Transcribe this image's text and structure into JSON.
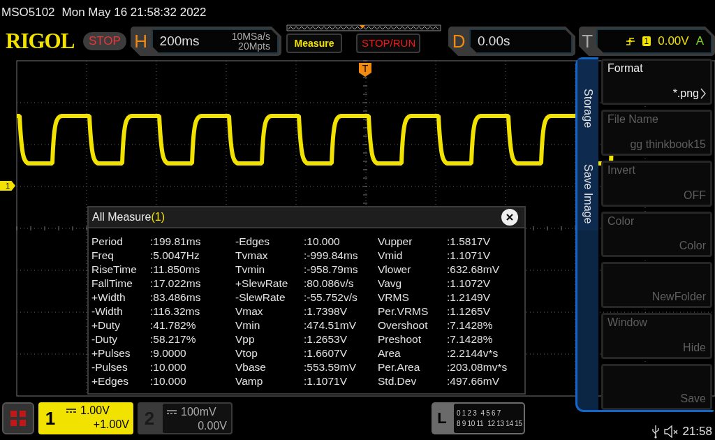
{
  "header": {
    "model": "MSO5102",
    "datetime": "Mon May 16 21:58:32 2022"
  },
  "toolbar": {
    "logo": "RIGOL",
    "run_state": "STOP",
    "horizontal": {
      "key": "H",
      "timebase": "200ms",
      "sample_rate": "10MSa/s",
      "memory_depth": "20Mpts"
    },
    "buttons": [
      {
        "label": "Measure",
        "kind": "measure"
      },
      {
        "label": "STOP/RUN",
        "kind": "stoprun"
      }
    ],
    "delay": {
      "key": "D",
      "value": "0.00s"
    },
    "trigger": {
      "key": "T",
      "source": "1",
      "level": "0.00V",
      "mode": "A"
    }
  },
  "display": {
    "channel_marker": "1",
    "trigger_marker": "T"
  },
  "measure_panel": {
    "title": "All Measure",
    "count": "(1)",
    "columns": [
      [
        {
          "name": "Period",
          "value": ":199.81ms"
        },
        {
          "name": "Freq",
          "value": ":5.0047Hz"
        },
        {
          "name": "RiseTime",
          "value": ":11.850ms"
        },
        {
          "name": "FallTime",
          "value": ":17.022ms"
        },
        {
          "name": "+Width",
          "value": ":83.486ms"
        },
        {
          "name": "-Width",
          "value": ":116.32ms"
        },
        {
          "name": "+Duty",
          "value": ":41.782%"
        },
        {
          "name": "-Duty",
          "value": ":58.217%"
        },
        {
          "name": "+Pulses",
          "value": ":9.0000"
        },
        {
          "name": "-Pulses",
          "value": ":10.000"
        },
        {
          "name": "+Edges",
          "value": ":10.000"
        }
      ],
      [
        {
          "name": "-Edges",
          "value": ":10.000"
        },
        {
          "name": "Tvmax",
          "value": ":-999.84ms"
        },
        {
          "name": "Tvmin",
          "value": ":-958.79ms"
        },
        {
          "name": "+SlewRate",
          "value": ":80.086v/s"
        },
        {
          "name": "-SlewRate",
          "value": ":-55.752v/s"
        },
        {
          "name": "Vmax",
          "value": ":1.7398V"
        },
        {
          "name": "Vmin",
          "value": ":474.51mV"
        },
        {
          "name": "Vpp",
          "value": ":1.2653V"
        },
        {
          "name": "Vtop",
          "value": ":1.6607V"
        },
        {
          "name": "Vbase",
          "value": ":553.59mV"
        },
        {
          "name": "Vamp",
          "value": ":1.1071V"
        }
      ],
      [
        {
          "name": "Vupper",
          "value": ":1.5817V"
        },
        {
          "name": "Vmid",
          "value": ":1.1071V"
        },
        {
          "name": "Vlower",
          "value": ":632.68mV"
        },
        {
          "name": "Vavg",
          "value": ":1.1072V"
        },
        {
          "name": "VRMS",
          "value": ":1.2149V"
        },
        {
          "name": "Per.VRMS",
          "value": ":1.1265V"
        },
        {
          "name": "Overshoot",
          "value": ":7.1428%"
        },
        {
          "name": "Preshoot",
          "value": ":7.1428%"
        },
        {
          "name": "Area",
          "value": ":2.2144v*s"
        },
        {
          "name": "Per.Area",
          "value": ":203.08mv*s"
        },
        {
          "name": "Std.Dev",
          "value": ":497.66mV"
        }
      ]
    ]
  },
  "side_menu": {
    "tabs": [
      "Storage",
      "Save Image"
    ],
    "items": [
      {
        "label": "Format",
        "value": "*.png",
        "disabled": false,
        "submenu": true
      },
      {
        "label": "File Name",
        "value": "gg thinkbook15",
        "disabled": true,
        "submenu": false
      },
      {
        "label": "Invert",
        "value": "OFF",
        "disabled": true,
        "submenu": false
      },
      {
        "label": "Color",
        "value": "Color",
        "disabled": true,
        "submenu": false
      },
      {
        "value": "NewFolder",
        "disabled": true,
        "submenu": false
      },
      {
        "label": "Window",
        "value": "Hide",
        "disabled": true,
        "submenu": false
      },
      {
        "value": "Save",
        "disabled": true,
        "submenu": false
      }
    ]
  },
  "channels": [
    {
      "number": "1",
      "scale": "1.00V",
      "offset": "+1.00V",
      "on": true
    },
    {
      "number": "2",
      "scale": "100mV",
      "offset": "0.00V",
      "on": false
    }
  ],
  "logic": {
    "key": "L",
    "rows": [
      [
        "0 1 2 3",
        "4 5 6 7"
      ],
      [
        "8 9 10 11",
        "12 13 14 15"
      ]
    ]
  },
  "status": {
    "time": "21:58"
  }
}
